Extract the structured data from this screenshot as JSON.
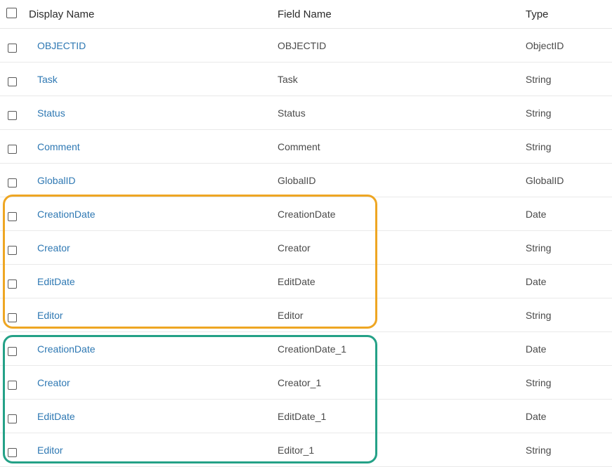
{
  "header": {
    "display_name": "Display Name",
    "field_name": "Field Name",
    "type": "Type"
  },
  "rows": [
    {
      "display": "OBJECTID",
      "field": "OBJECTID",
      "type": "ObjectID"
    },
    {
      "display": "Task",
      "field": "Task",
      "type": "String"
    },
    {
      "display": "Status",
      "field": "Status",
      "type": "String"
    },
    {
      "display": "Comment",
      "field": "Comment",
      "type": "String"
    },
    {
      "display": "GlobalID",
      "field": "GlobalID",
      "type": "GlobalID"
    },
    {
      "display": "CreationDate",
      "field": "CreationDate",
      "type": "Date"
    },
    {
      "display": "Creator",
      "field": "Creator",
      "type": "String"
    },
    {
      "display": "EditDate",
      "field": "EditDate",
      "type": "Date"
    },
    {
      "display": "Editor",
      "field": "Editor",
      "type": "String"
    },
    {
      "display": "CreationDate",
      "field": "CreationDate_1",
      "type": "Date"
    },
    {
      "display": "Creator",
      "field": "Creator_1",
      "type": "String"
    },
    {
      "display": "EditDate",
      "field": "EditDate_1",
      "type": "Date"
    },
    {
      "display": "Editor",
      "field": "Editor_1",
      "type": "String"
    }
  ],
  "colors": {
    "link": "#2e78b3",
    "highlight_orange": "#eea623",
    "highlight_teal": "#24a187"
  }
}
